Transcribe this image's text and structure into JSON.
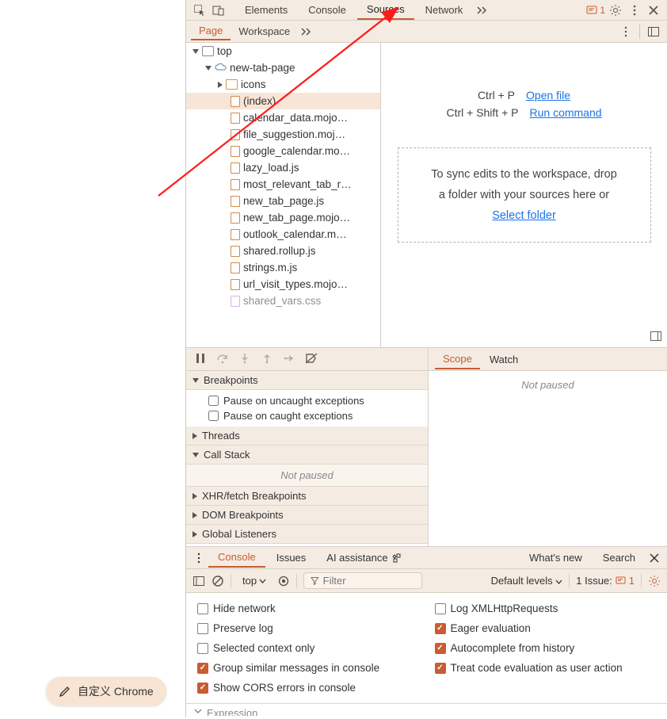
{
  "top_tabs": {
    "elements": "Elements",
    "console": "Console",
    "sources": "Sources",
    "network": "Network"
  },
  "issue_count": "1",
  "sub_tabs": {
    "page": "Page",
    "workspace": "Workspace"
  },
  "tree": {
    "top": "top",
    "domain": "new-tab-page",
    "icons_folder": "icons",
    "files": [
      "(index)",
      "calendar_data.mojo…",
      "file_suggestion.moj…",
      "google_calendar.mo…",
      "lazy_load.js",
      "most_relevant_tab_r…",
      "new_tab_page.js",
      "new_tab_page.mojo…",
      "outlook_calendar.m…",
      "shared.rollup.js",
      "strings.m.js",
      "url_visit_types.mojo…",
      "shared_vars.css"
    ]
  },
  "editor": {
    "open_file_kbd": "Ctrl + P",
    "open_file": "Open file",
    "run_cmd_kbd": "Ctrl + Shift + P",
    "run_cmd": "Run command",
    "drop_text1": "To sync edits to the workspace, drop",
    "drop_text2": "a folder with your sources here or",
    "select_folder": "Select folder"
  },
  "debugger": {
    "scope": "Scope",
    "watch": "Watch",
    "breakpoints": "Breakpoints",
    "pause_uncaught": "Pause on uncaught exceptions",
    "pause_caught": "Pause on caught exceptions",
    "threads": "Threads",
    "call_stack": "Call Stack",
    "not_paused": "Not paused",
    "xhr_bp": "XHR/fetch Breakpoints",
    "dom_bp": "DOM Breakpoints",
    "global_listeners": "Global Listeners"
  },
  "drawer": {
    "console": "Console",
    "issues": "Issues",
    "ai": "AI assistance",
    "whatsnew": "What's new",
    "search": "Search"
  },
  "console": {
    "context": "top",
    "filter_placeholder": "Filter",
    "default_levels": "Default levels",
    "issue_label": "1 Issue:",
    "issue_count": "1"
  },
  "settings": {
    "hide_network": "Hide network",
    "log_xhr": "Log XMLHttpRequests",
    "preserve_log": "Preserve log",
    "eager_eval": "Eager evaluation",
    "selected_ctx": "Selected context only",
    "autocomplete": "Autocomplete from history",
    "group_similar": "Group similar messages in console",
    "treat_code": "Treat code evaluation as user action",
    "show_cors": "Show CORS errors in console"
  },
  "expression": "Expression",
  "customize": "自定义 Chrome"
}
